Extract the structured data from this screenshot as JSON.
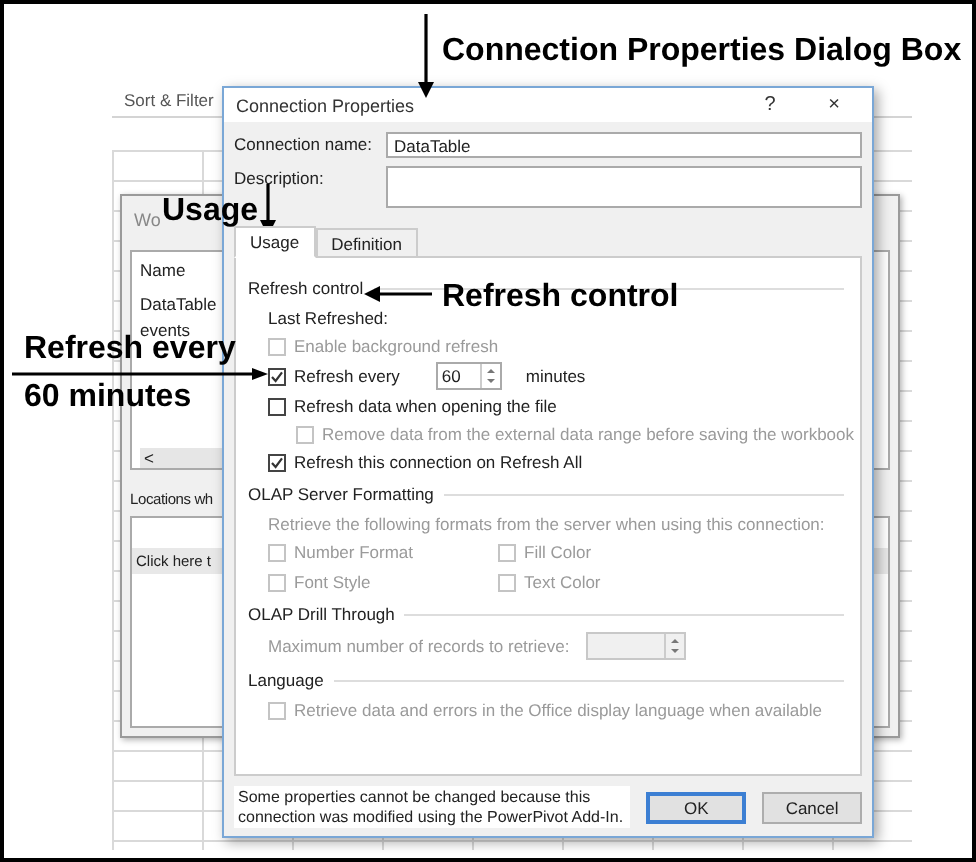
{
  "background_app": {
    "ribbon_label": "Sort & Filter"
  },
  "back_dialog": {
    "title": "Wo",
    "column_header": "Name",
    "items": [
      "DataTable",
      "events"
    ],
    "scroll_button": "<",
    "locations_label": "Locations wh",
    "locations_row": "Click here t"
  },
  "dialog": {
    "title": "Connection Properties",
    "help": "?",
    "close": "×",
    "connection_name": {
      "label": "Connection name:",
      "value": "DataTable"
    },
    "description": {
      "label": "Description:"
    },
    "tabs": [
      {
        "label": "Usage",
        "selected": true
      },
      {
        "label": "Definition",
        "selected": false
      }
    ],
    "sections": [
      {
        "title": "Refresh control",
        "rows": [
          {
            "kind": "text",
            "text": "Last Refreshed:",
            "disabled": false
          },
          {
            "kind": "checkbox",
            "label": "Enable background refresh",
            "checked": false,
            "disabled": true
          },
          {
            "kind": "interval",
            "label": "Refresh every",
            "checked": true,
            "disabled": false,
            "value": "60",
            "unit": "minutes"
          },
          {
            "kind": "checkbox",
            "label": "Refresh data when opening the file",
            "checked": false,
            "disabled": false,
            "children": [
              {
                "kind": "checkbox",
                "label": "Remove data from the external data range before saving the workbook",
                "checked": false,
                "disabled": true
              }
            ]
          },
          {
            "kind": "checkbox",
            "label": "Refresh this connection on Refresh All",
            "checked": true,
            "disabled": false
          }
        ]
      },
      {
        "title": "OLAP Server Formatting",
        "rows": [
          {
            "kind": "text",
            "text": "Retrieve the following formats from the server when using this connection:",
            "disabled": true
          },
          {
            "kind": "checkbox_grid",
            "items": [
              {
                "label": "Number Format",
                "checked": false,
                "disabled": true
              },
              {
                "label": "Fill Color",
                "checked": false,
                "disabled": true
              },
              {
                "label": "Font Style",
                "checked": false,
                "disabled": true
              },
              {
                "label": "Text Color",
                "checked": false,
                "disabled": true
              }
            ]
          }
        ]
      },
      {
        "title": "OLAP Drill Through",
        "rows": [
          {
            "kind": "number_field",
            "label": "Maximum number of records to retrieve:",
            "disabled": true
          }
        ]
      },
      {
        "title": "Language",
        "rows": [
          {
            "kind": "checkbox",
            "label": "Retrieve data and errors in the Office display language when available",
            "checked": false,
            "disabled": true
          }
        ]
      }
    ],
    "note": "Some properties cannot be changed because this connection was modified using the PowerPivot Add-In.",
    "buttons": [
      {
        "label": "OK",
        "default": true
      },
      {
        "label": "Cancel",
        "default": false
      }
    ]
  },
  "annotations": [
    {
      "text": "Connection Properties Dialog Box",
      "kind": "arrow_down"
    },
    {
      "text": "Usage",
      "kind": "arrow_down"
    },
    {
      "text": "Refresh control",
      "kind": "arrow_left"
    },
    {
      "lines": [
        "Refresh every",
        "60 minutes"
      ],
      "kind": "arrow_right"
    }
  ]
}
